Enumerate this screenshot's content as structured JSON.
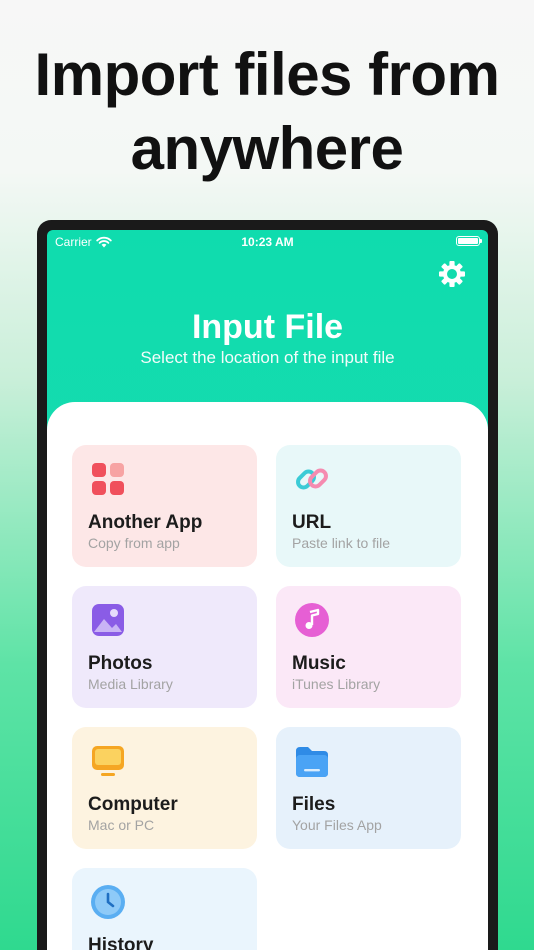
{
  "headline": {
    "line1": "Import files from",
    "line2": "anywhere"
  },
  "statusbar": {
    "carrier": "Carrier",
    "time": "10:23 AM"
  },
  "header": {
    "title": "Input File",
    "subtitle": "Select the location of the input file"
  },
  "sources": [
    {
      "label": "Another App",
      "sub": "Copy from app",
      "icon": "apps-grid-icon"
    },
    {
      "label": "URL",
      "sub": "Paste link to file",
      "icon": "link-icon"
    },
    {
      "label": "Photos",
      "sub": "Media Library",
      "icon": "photos-icon"
    },
    {
      "label": "Music",
      "sub": "iTunes Library",
      "icon": "music-note-icon"
    },
    {
      "label": "Computer",
      "sub": "Mac or PC",
      "icon": "computer-icon"
    },
    {
      "label": "Files",
      "sub": "Your Files App",
      "icon": "folder-icon"
    },
    {
      "label": "History",
      "sub": "",
      "icon": "clock-icon"
    }
  ],
  "colors": {
    "header_gradient_top": "#0fdcae",
    "header_gradient_bottom": "#22d9b1",
    "page_gradient_bottom": "#2fd98f"
  }
}
